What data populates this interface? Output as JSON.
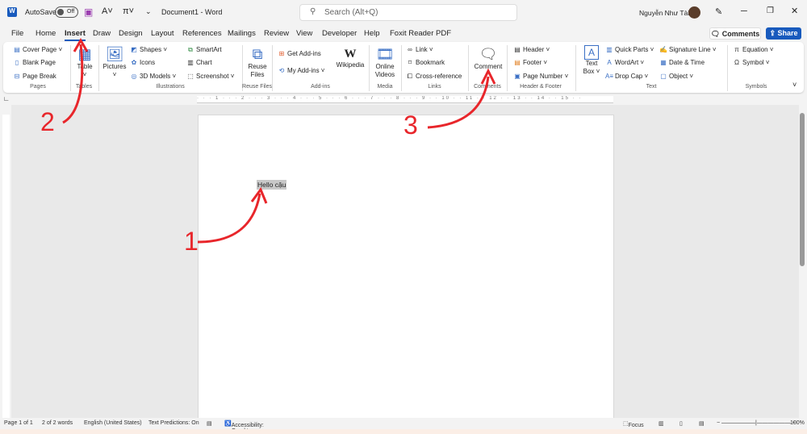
{
  "titlebar": {
    "autosave": "AutoSave",
    "toggle": "Off",
    "doc_title": "Document1 - Word",
    "search_placeholder": "Search (Alt+Q)",
    "user": "Nguyễn Như Tài"
  },
  "tabs": [
    "File",
    "Home",
    "Insert",
    "Draw",
    "Design",
    "Layout",
    "References",
    "Mailings",
    "Review",
    "View",
    "Developer",
    "Help",
    "Foxit Reader PDF"
  ],
  "active_tab": "Insert",
  "actions": {
    "comments": "Comments",
    "share": "Share"
  },
  "ribbon": {
    "pages": {
      "label": "Pages",
      "items": [
        "Cover Page",
        "Blank Page",
        "Page Break"
      ]
    },
    "tables": {
      "label": "Tables",
      "table": "Table"
    },
    "illustrations": {
      "label": "Illustrations",
      "pictures": "Pictures",
      "items": [
        "Shapes",
        "Icons",
        "3D Models",
        "SmartArt",
        "Chart",
        "Screenshot"
      ]
    },
    "reuse": {
      "label": "Reuse Files",
      "button": "Reuse Files"
    },
    "addins": {
      "label": "Add-ins",
      "get": "Get Add-ins",
      "my": "My Add-ins",
      "wiki": "Wikipedia"
    },
    "media": {
      "label": "Media",
      "button": "Online Videos"
    },
    "links": {
      "label": "Links",
      "items": [
        "Link",
        "Bookmark",
        "Cross-reference"
      ]
    },
    "comments": {
      "label": "Comments",
      "button": "Comment"
    },
    "header_footer": {
      "label": "Header & Footer",
      "items": [
        "Header",
        "Footer",
        "Page Number"
      ]
    },
    "text": {
      "label": "Text",
      "textbox": "Text Box",
      "items": [
        "Quick Parts",
        "WordArt",
        "Drop Cap",
        "Signature Line",
        "Date & Time",
        "Object"
      ]
    },
    "symbols": {
      "label": "Symbols",
      "items": [
        "Equation",
        "Symbol"
      ]
    }
  },
  "document": {
    "text": "Hello cậu"
  },
  "annotations": [
    "1",
    "2",
    "3"
  ],
  "annotation_color": "#e8262b",
  "status": {
    "page": "Page 1 of 1",
    "words": "2 of 2 words",
    "language": "English (United States)",
    "predictions": "Text Predictions: On",
    "accessibility": "Accessibility: Good to go",
    "focus": "Focus",
    "zoom": "100%"
  }
}
